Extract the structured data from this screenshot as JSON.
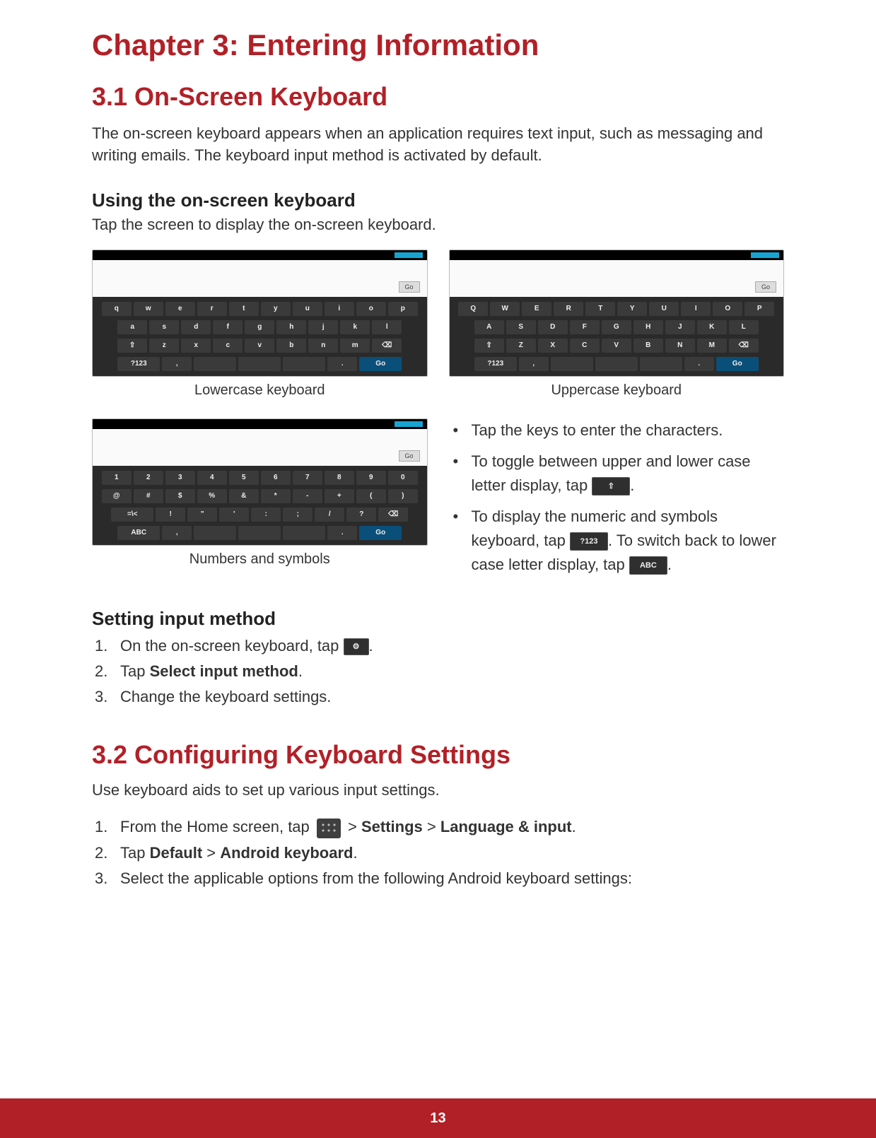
{
  "chapter_title": "Chapter 3: Entering Information",
  "s31": {
    "heading": "3.1 On-Screen Keyboard",
    "intro": "The on-screen keyboard appears when an application requires text input, such as messaging and writing emails. The keyboard input method is activated by default.",
    "using_heading": "Using the on-screen keyboard",
    "using_text": "Tap the screen to display the on-screen keyboard.",
    "captions": {
      "lower": "Lowercase keyboard",
      "upper": "Uppercase keyboard",
      "numsym": "Numbers and symbols"
    },
    "go_label": "Go",
    "tips": {
      "t1": "Tap the keys to enter the characters.",
      "t2a": "To toggle between upper and lower case letter display, tap ",
      "t2b": ".",
      "t3a": "To display the numeric and symbols keyboard, tap ",
      "t3b": ". To switch back to lower case letter display, tap ",
      "t3c": "."
    },
    "icons": {
      "shift": "⇧",
      "mode_num": "?123",
      "mode_abc": "ABC",
      "gear": "⚙"
    },
    "setmethod": {
      "heading": "Setting input method",
      "s1a": "On the on-screen keyboard, tap ",
      "s1b": ".",
      "s2a": "Tap ",
      "s2b": "Select input method",
      "s2c": ".",
      "s3": "Change the keyboard settings."
    }
  },
  "s32": {
    "heading": "3.2 Configuring Keyboard Settings",
    "intro": "Use keyboard aids to set up various input settings.",
    "s1a": "From the Home screen, tap ",
    "s1b": " > ",
    "s1c": "Settings",
    "s1d": " > ",
    "s1e": "Language & input",
    "s1f": ".",
    "s2a": "Tap ",
    "s2b": "Default",
    "s2c": "  > ",
    "s2d": "Android keyboard",
    "s2e": ".",
    "s3": "Select the applicable options from the following Android keyboard settings:"
  },
  "kb": {
    "lower": {
      "r1": [
        "q",
        "w",
        "e",
        "r",
        "t",
        "y",
        "u",
        "i",
        "o",
        "p"
      ],
      "r2": [
        "a",
        "s",
        "d",
        "f",
        "g",
        "h",
        "j",
        "k",
        "l"
      ],
      "r3": [
        "⇧",
        "z",
        "x",
        "c",
        "v",
        "b",
        "n",
        "m",
        "⌫"
      ],
      "r4": [
        "?123",
        ",",
        "",
        "",
        "",
        ".",
        "Go"
      ]
    },
    "upper": {
      "r1": [
        "Q",
        "W",
        "E",
        "R",
        "T",
        "Y",
        "U",
        "I",
        "O",
        "P"
      ],
      "r2": [
        "A",
        "S",
        "D",
        "F",
        "G",
        "H",
        "J",
        "K",
        "L"
      ],
      "r3": [
        "⇧",
        "Z",
        "X",
        "C",
        "V",
        "B",
        "N",
        "M",
        "⌫"
      ],
      "r4": [
        "?123",
        ",",
        "",
        "",
        "",
        ".",
        "Go"
      ]
    },
    "num": {
      "r1": [
        "1",
        "2",
        "3",
        "4",
        "5",
        "6",
        "7",
        "8",
        "9",
        "0"
      ],
      "r2": [
        "@",
        "#",
        "$",
        "%",
        "&",
        "*",
        "-",
        "+",
        "(",
        ")"
      ],
      "r3": [
        "=\\<",
        "!",
        "\"",
        "'",
        ":",
        ";",
        "/",
        "?",
        "⌫"
      ],
      "r4": [
        "ABC",
        ",",
        "",
        "",
        "",
        ".",
        "Go"
      ]
    }
  },
  "page_number": "13"
}
